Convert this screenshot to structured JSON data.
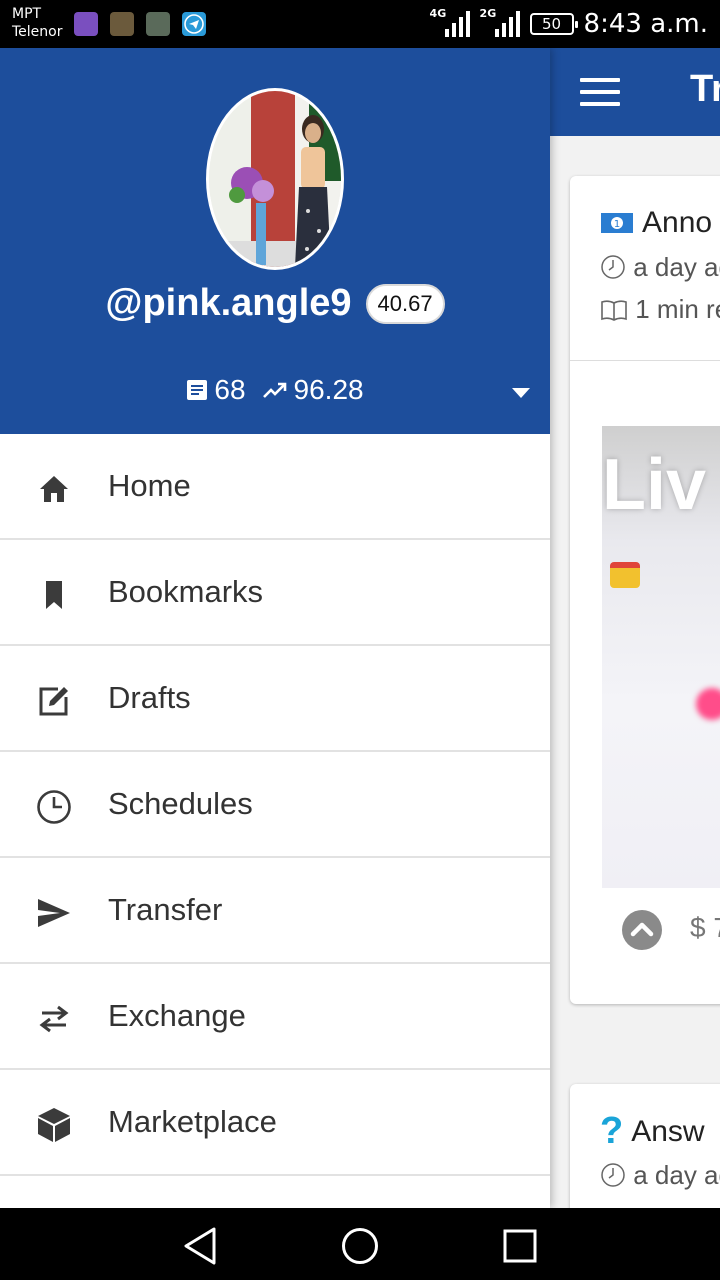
{
  "status_bar": {
    "carrier_1": "MPT",
    "carrier_2": "Telenor",
    "network_1": "4G",
    "network_2": "2G",
    "battery": "50",
    "time": "8:43 a.m."
  },
  "background_app": {
    "title_partial": "Tr",
    "post_1": {
      "title_partial": "Anno",
      "time_partial": "a day ag",
      "read_time_partial": "1 min re",
      "image_text_partial": "Liv",
      "payout_partial": "$ 7"
    },
    "post_2": {
      "title_partial": "Answ",
      "time_partial": "a day ag"
    }
  },
  "drawer": {
    "username": "@pink.angle9",
    "reputation": "40.67",
    "post_count": "68",
    "voting_power": "96.28",
    "menu": [
      {
        "label": "Home",
        "icon": "home-icon"
      },
      {
        "label": "Bookmarks",
        "icon": "bookmark-icon"
      },
      {
        "label": "Drafts",
        "icon": "edit-icon"
      },
      {
        "label": "Schedules",
        "icon": "clock-icon"
      },
      {
        "label": "Transfer",
        "icon": "send-icon"
      },
      {
        "label": "Exchange",
        "icon": "swap-icon"
      },
      {
        "label": "Marketplace",
        "icon": "cube-icon"
      }
    ]
  },
  "colors": {
    "primary": "#1d4e9c",
    "menu_text": "#333333",
    "divider": "#e2e2e2"
  }
}
